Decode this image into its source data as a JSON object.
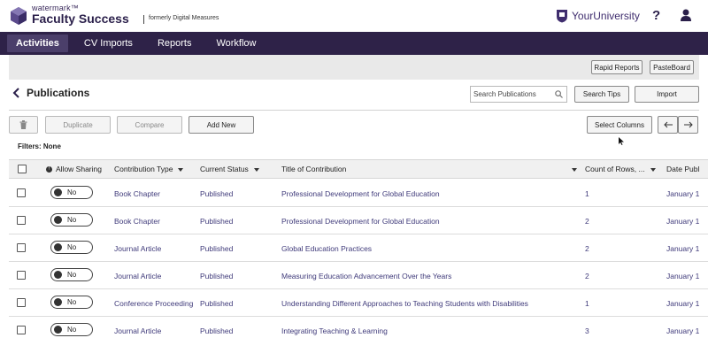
{
  "header": {
    "brand_top": "watermark™",
    "brand_main": "Faculty Success",
    "brand_former": "formerly Digital Measures",
    "university": "YourUniversity",
    "help": "?"
  },
  "nav": {
    "items": [
      "Activities",
      "CV Imports",
      "Reports",
      "Workflow"
    ]
  },
  "toolbar": {
    "rapid_reports": "Rapid Reports",
    "pasteboard": "PasteBoard"
  },
  "page": {
    "title": "Publications",
    "search_placeholder": "Search Publications",
    "search_tips": "Search Tips",
    "import": "Import"
  },
  "actions": {
    "duplicate": "Duplicate",
    "compare": "Compare",
    "add_new": "Add New",
    "select_columns": "Select Columns"
  },
  "filters": "Filters: None",
  "table": {
    "columns": [
      "Allow Sharing",
      "Contribution Type",
      "Current Status",
      "Title of Contribution",
      "Count of Rows, ...",
      "Date Publ"
    ],
    "rows": [
      {
        "sharing": "No",
        "type": "Book Chapter",
        "status": "Published",
        "title": "Professional Development for Global Education",
        "count": "1",
        "date": "January 1"
      },
      {
        "sharing": "No",
        "type": "Book Chapter",
        "status": "Published",
        "title": "Professional Development for Global Education",
        "count": "2",
        "date": "January 1"
      },
      {
        "sharing": "No",
        "type": "Journal Article",
        "status": "Published",
        "title": "Global Education Practices",
        "count": "2",
        "date": "January 1"
      },
      {
        "sharing": "No",
        "type": "Journal Article",
        "status": "Published",
        "title": "Measuring Education Advancement Over the Years",
        "count": "2",
        "date": "January 1"
      },
      {
        "sharing": "No",
        "type": "Conference Proceeding",
        "status": "Published",
        "title": "Understanding Different Approaches to Teaching Students with Disabilities",
        "count": "1",
        "date": "January 1"
      },
      {
        "sharing": "No",
        "type": "Journal Article",
        "status": "Published",
        "title": "Integrating Teaching & Learning",
        "count": "3",
        "date": "January 1"
      }
    ]
  },
  "colors": {
    "nav_bg": "#2e2248",
    "nav_active": "#4b3f6a",
    "link": "#3f3a7a"
  }
}
